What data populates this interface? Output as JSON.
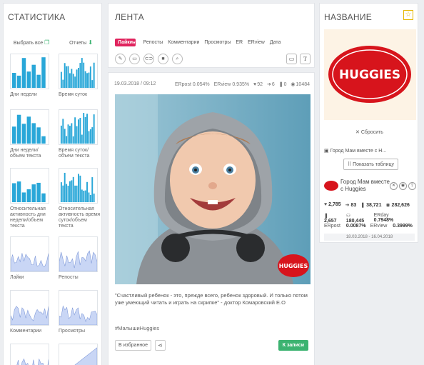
{
  "stats_panel": {
    "title": "СТАТИСТИКА",
    "select_all_label": "Выбрать все",
    "reports_label": "Отчеты",
    "tiles": [
      {
        "label": "Дни недели",
        "kind": "bars"
      },
      {
        "label": "Время суток",
        "kind": "bars"
      },
      {
        "label": "Дни недели/ объем текста",
        "kind": "bars"
      },
      {
        "label": "Время суток/ объем текста",
        "kind": "bars"
      },
      {
        "label": "Относительная активность дни недели/объем текста",
        "kind": "bars"
      },
      {
        "label": "Относительная активность время суток/объем текста",
        "kind": "bars"
      },
      {
        "label": "Лайки",
        "kind": "area"
      },
      {
        "label": "Репосты",
        "kind": "area"
      },
      {
        "label": "Комментарии",
        "kind": "area"
      },
      {
        "label": "Просмотры",
        "kind": "area"
      },
      {
        "label": "",
        "kind": "area"
      },
      {
        "label": "",
        "kind": "area"
      }
    ],
    "accent_color": "#29a7d8",
    "area_color": "#c9d6f5"
  },
  "feed": {
    "title": "ЛЕНТА",
    "sort_tabs": [
      {
        "label": "Лайки",
        "active": true
      },
      {
        "label": "Репосты"
      },
      {
        "label": "Комментарии"
      },
      {
        "label": "Просмотры"
      },
      {
        "label": "ER"
      },
      {
        "label": "ERview"
      },
      {
        "label": "Дата"
      }
    ],
    "filter_icons": [
      "pencil-icon",
      "message-icon",
      "link-icon",
      "video-icon",
      "search-icon"
    ],
    "text_toggle_label": "T"
  },
  "post": {
    "date": "19.03.2018 / 09:12",
    "erpost_label": "ERpost",
    "erpost_value": "0.054%",
    "erview_label": "ERview",
    "erview_value": "0.935%",
    "likes": "92",
    "reposts": "6",
    "comments": "0",
    "views": "10484",
    "text": "\"Счастливый ребенок - это, прежде всего, ребенок здоровый. И только потом уже умеющий читать и играть на скрипке\" - доктор Комаровский Е.О",
    "hashtag": "#МалышиHuggies",
    "favorite_label": "В избранное",
    "to_post_label": "К записи",
    "watermark_text": "HUGGIES"
  },
  "name_panel": {
    "title": "НАЗВАНИЕ",
    "logo_text": "HUGGIES",
    "reset_label": "Сбросить",
    "group_short": "Город Мам вместе с Н...",
    "show_table_label": "Показать таблицу",
    "group_name": "Город Мам вместе с Huggies",
    "stats_row1": {
      "likes": "2,785",
      "reposts": "83",
      "comments": "38,721",
      "views": "282,626"
    },
    "stats_row2": {
      "posts": "2,657",
      "members": "180,445",
      "erday_label": "ERday",
      "erday_value": "0.7948%"
    },
    "stats_row3": {
      "erpost_label": "ERpost",
      "erpost_value": "0.0087%",
      "erview_label": "ERview",
      "erview_value": "0.3999%"
    },
    "date_range": "18.03.2018 - 16.04.2018"
  }
}
